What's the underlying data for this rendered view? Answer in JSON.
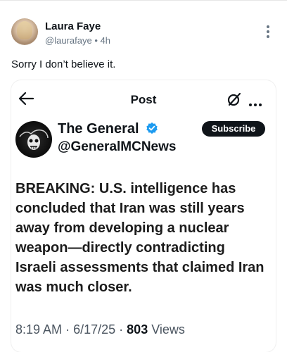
{
  "post": {
    "author_name": "Laura Faye",
    "author_handle": "@laurafaye",
    "separator": "•",
    "time": "4h",
    "text": "Sorry I don’t believe it."
  },
  "embedded": {
    "header_title": "Post",
    "account_name": "The General",
    "account_handle": "@GeneralMCNews",
    "subscribe_label": "Subscribe",
    "body": "BREAKING: U.S. intelligence has concluded that Iran was still years away from developing a nuclear weapon—directly contradicting Israeli assessments that claimed Iran was much closer.",
    "time": "8:19 AM",
    "date": "6/17/25",
    "dot": "·",
    "views_count": "803",
    "views_label": "Views"
  },
  "icons": [
    "back-arrow-icon",
    "more-vertical-icon",
    "grok-icon",
    "more-horizontal-icon",
    "verified-badge-icon"
  ],
  "colors": {
    "verified": "#1d9bf0",
    "subscribe_bg": "#0f1419",
    "meta_text": "#687684"
  }
}
